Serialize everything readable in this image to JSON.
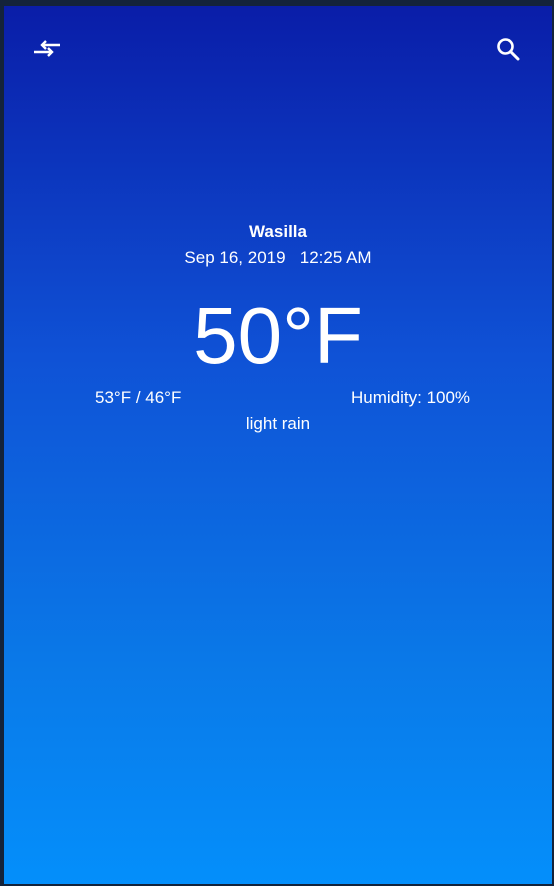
{
  "header": {
    "swap_icon": "swap-units-icon",
    "search_icon": "search-icon"
  },
  "weather": {
    "city": "Wasilla",
    "datetime": "Sep 16, 2019   12:25 AM",
    "temperature": "50°F",
    "range": "53°F / 46°F",
    "humidity": "Humidity: 100%",
    "description": "light rain"
  },
  "colors": {
    "gradient_top": "#0a1da8",
    "gradient_bottom": "#048ffb",
    "text": "#ffffff"
  }
}
